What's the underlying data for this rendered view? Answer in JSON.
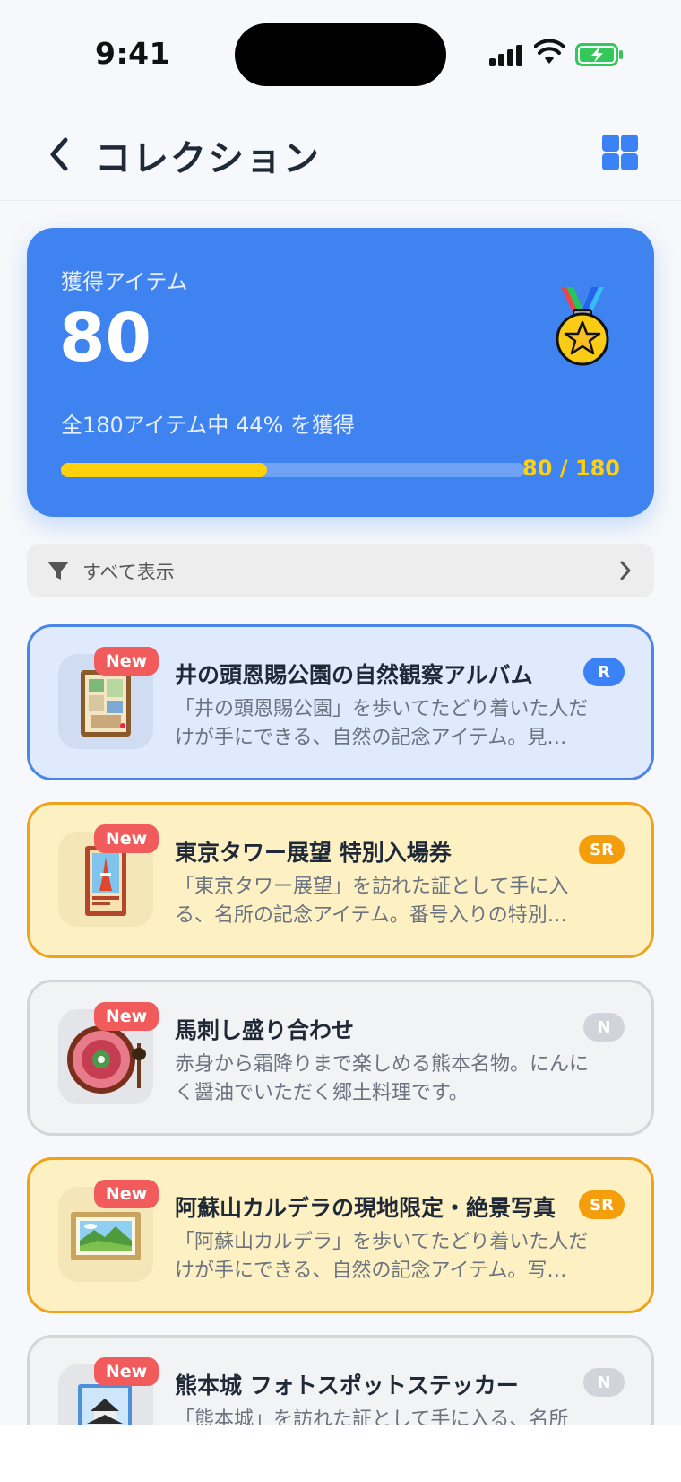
{
  "status_bar": {
    "time": "9:41"
  },
  "header": {
    "title": "コレクション",
    "back_icon": "chevron-left-icon",
    "view_icon": "grid-icon"
  },
  "summary": {
    "label": "獲得アイテム",
    "count": "80",
    "subtext": "全180アイテム中 44% を獲得",
    "progress_fraction": 0.444,
    "fraction_text": "80 / 180",
    "accent": "#3f83f0",
    "progress_color": "#ffd10a"
  },
  "filter": {
    "label": "すべて表示",
    "icon": "filter-icon"
  },
  "items": [
    {
      "new_label": "New",
      "title": "井の頭恩賜公園の自然観察アルバム",
      "rarity": "R",
      "description": "「井の頭恩賜公園」を歩いてたどり着いた人だけが手にできる、自然の記念アイテム。見…",
      "tier": "r",
      "icon": "photo-album-icon"
    },
    {
      "new_label": "New",
      "title": "東京タワー展望 特別入場券",
      "rarity": "SR",
      "description": "「東京タワー展望」を訪れた証として手に入る、名所の記念アイテム。番号入りの特別…",
      "tier": "sr",
      "icon": "tokyo-tower-ticket-icon"
    },
    {
      "new_label": "New",
      "title": "馬刺し盛り合わせ",
      "rarity": "N",
      "description": "赤身から霜降りまで楽しめる熊本名物。にんにく醤油でいただく郷土料理です。",
      "tier": "n",
      "icon": "horse-sashimi-plate-icon"
    },
    {
      "new_label": "New",
      "title": "阿蘇山カルデラの現地限定・絶景写真",
      "rarity": "SR",
      "description": "「阿蘇山カルデラ」を歩いてたどり着いた人だけが手にできる、自然の記念アイテム。写…",
      "tier": "sr",
      "icon": "framed-landscape-icon"
    },
    {
      "new_label": "New",
      "title": "熊本城 フォトスポットステッカー",
      "rarity": "N",
      "description": "「熊本城」を訪れた証として手に入る、名所の…",
      "tier": "n",
      "icon": "castle-sticker-icon"
    }
  ]
}
